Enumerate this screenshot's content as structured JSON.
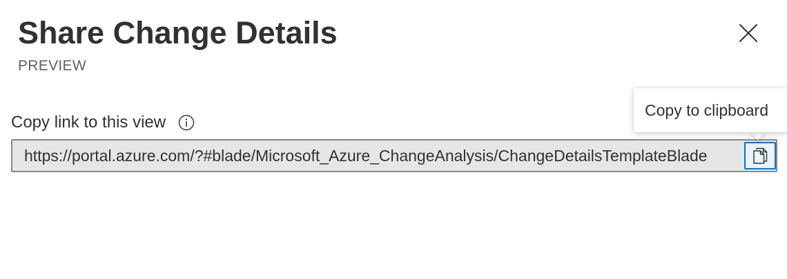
{
  "header": {
    "title": "Share Change Details",
    "subtitle": "PREVIEW"
  },
  "field": {
    "label": "Copy link to this view",
    "value": "https://portal.azure.com/?#blade/Microsoft_Azure_ChangeAnalysis/ChangeDetailsTemplateBlade"
  },
  "tooltip": {
    "text": "Copy to clipboard"
  },
  "icons": {
    "close": "close-icon",
    "info": "info-icon",
    "copy": "copy-icon"
  },
  "colors": {
    "accent": "#0078d4",
    "text": "#323130",
    "subtext": "#605e5c",
    "field_background": "#e6e6e6",
    "field_border": "#8a8886"
  }
}
